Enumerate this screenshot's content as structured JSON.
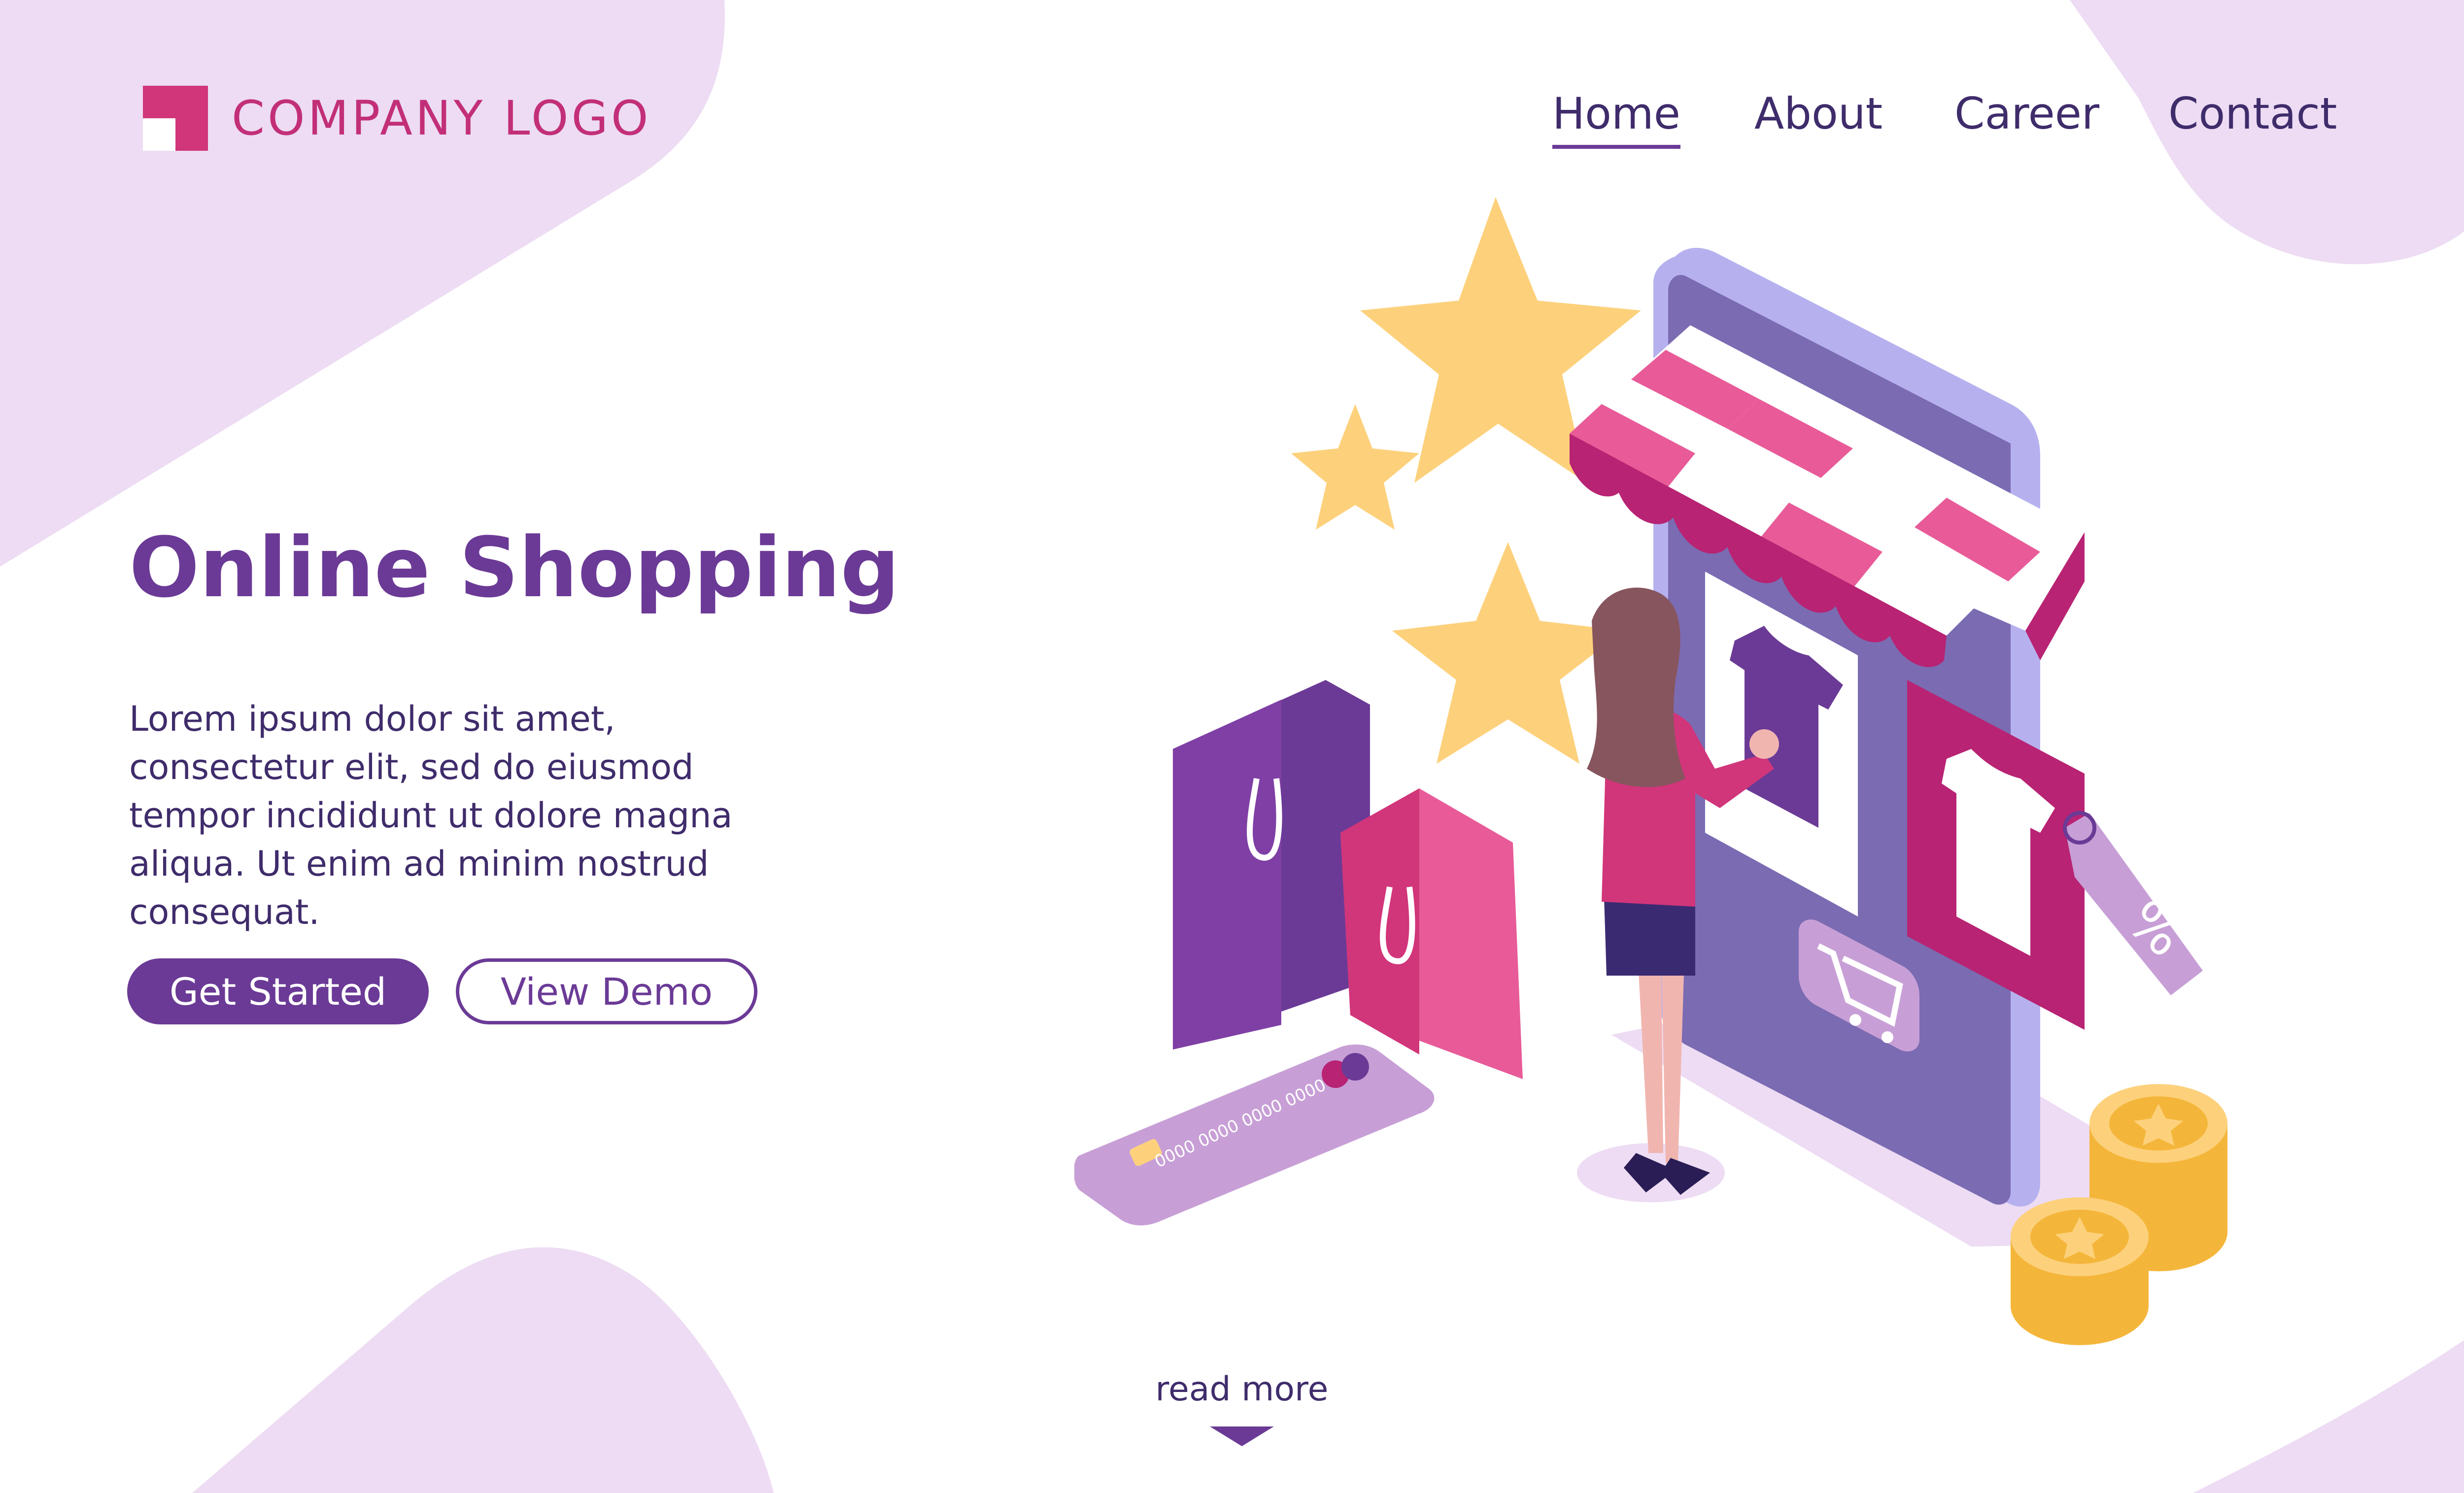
{
  "logo": {
    "text": "COMPANY LOGO",
    "mark_icon": "logo-square-icon",
    "primary_color": "#d1357a"
  },
  "nav": {
    "items": [
      {
        "label": "Home",
        "active": true
      },
      {
        "label": "About",
        "active": false
      },
      {
        "label": "Career",
        "active": false
      },
      {
        "label": "Contact",
        "active": false
      }
    ]
  },
  "hero": {
    "title": "Online Shopping",
    "body": "Lorem ipsum dolor sit amet, consectetur elit, sed do eiusmod tempor incididunt ut dolore magna aliqua. Ut enim ad minim nostrud consequat.",
    "primary_button": "Get Started",
    "secondary_button": "View Demo"
  },
  "illustration": {
    "card_number": "0000 0000 0000 0000",
    "tag_text": "%",
    "icons": [
      "star-icon",
      "shopping-bag-icon",
      "credit-card-icon",
      "shop-awning-icon",
      "tshirt-icon",
      "cart-icon",
      "price-tag-icon",
      "coin-icon",
      "woman-shopper"
    ]
  },
  "footer": {
    "read_more": "read more",
    "arrow_icon": "chevron-down-icon"
  },
  "colors": {
    "accent": "#6b3a96",
    "pink": "#d1357a",
    "text_dark": "#3f2c6b",
    "blob": "#eddcf3",
    "star": "#fdd17c"
  }
}
